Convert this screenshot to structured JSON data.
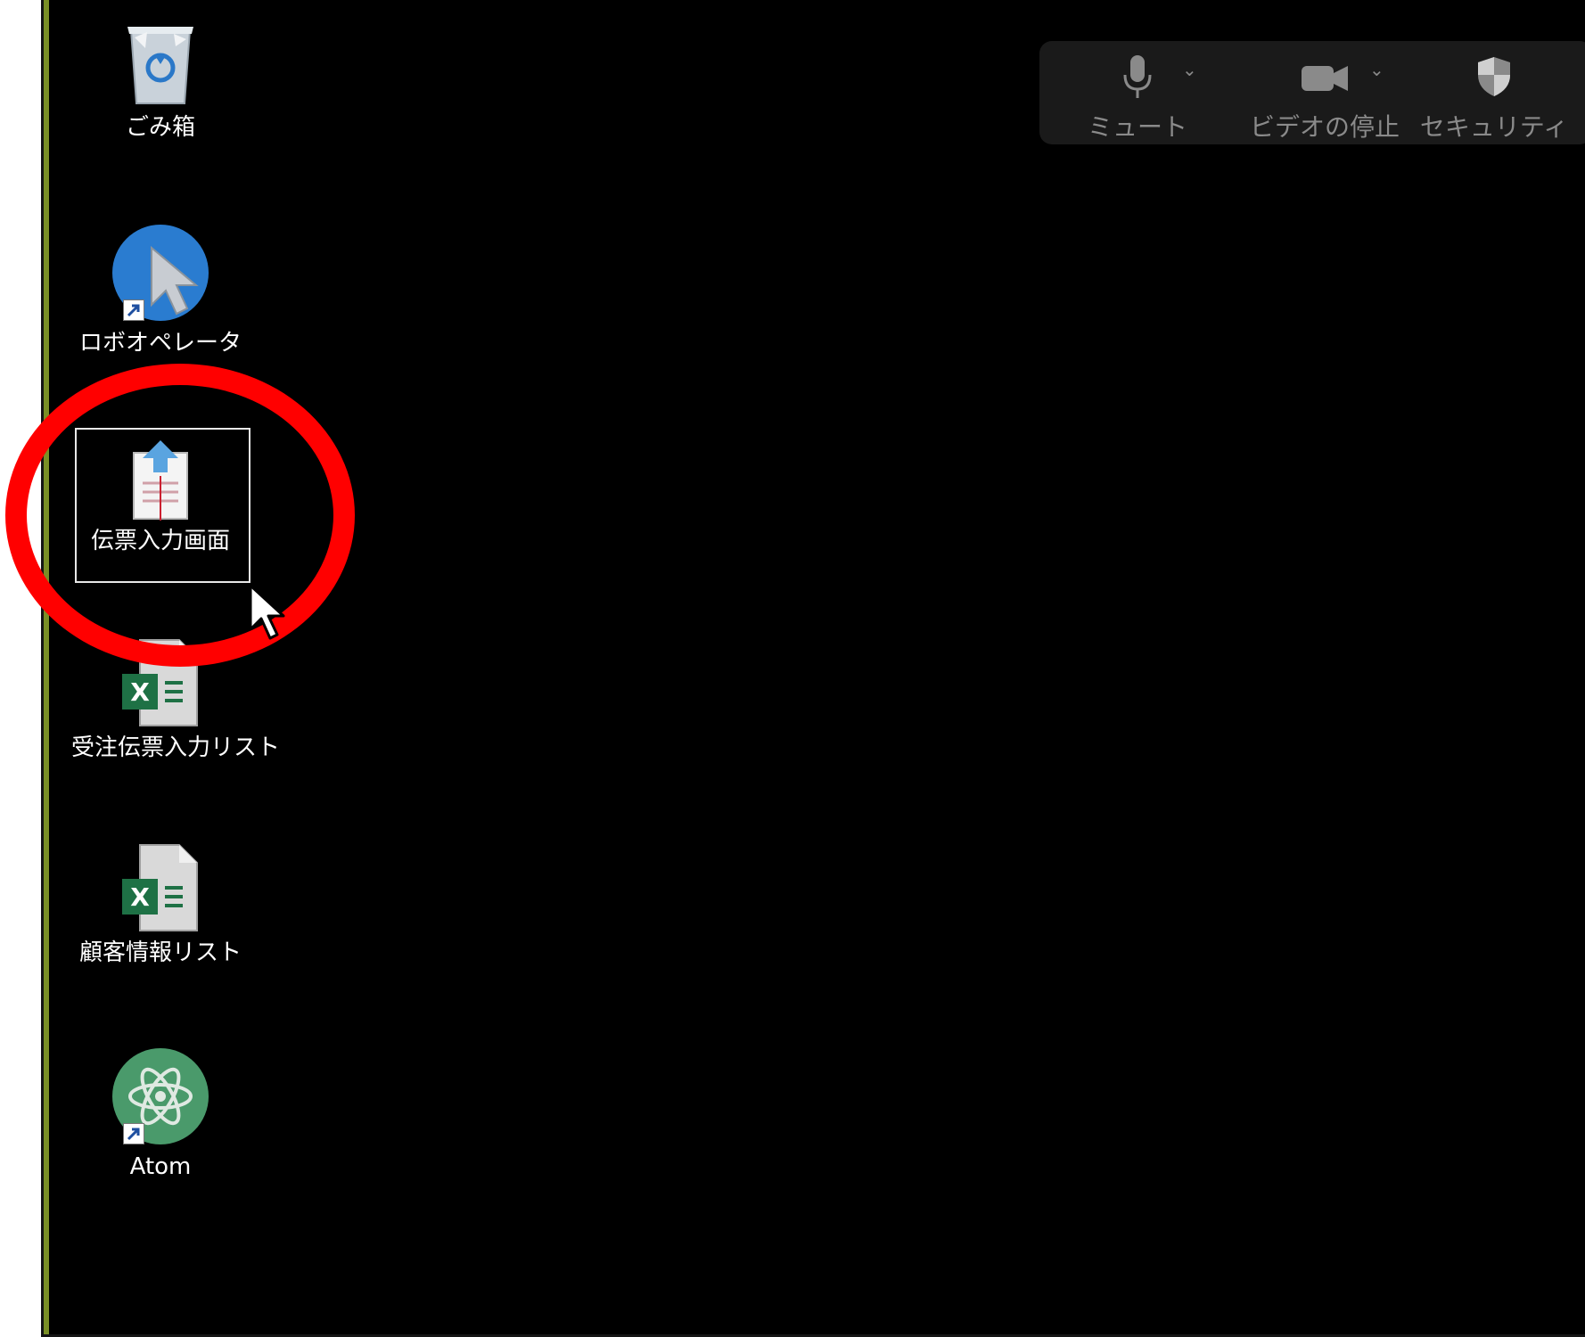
{
  "desktop": {
    "icons": [
      {
        "label": "ごみ箱",
        "icon": "recycle-bin-icon"
      },
      {
        "label": "ロボオペレータ",
        "icon": "robo-operator-icon"
      },
      {
        "label": "伝票入力画面",
        "icon": "document-upload-icon"
      },
      {
        "label": "受注伝票入力リスト",
        "icon": "excel-file-icon"
      },
      {
        "label": "顧客情報リスト",
        "icon": "excel-file-icon"
      },
      {
        "label": "Atom",
        "icon": "atom-icon"
      }
    ]
  },
  "meeting_toolbar": {
    "mute_label": "ミュート",
    "video_label": "ビデオの停止",
    "security_label": "セキュリティ"
  },
  "colors": {
    "frame_border": "#7a8f26",
    "highlight_ring": "#ff0000",
    "excel_green": "#1e7145",
    "atom_green": "#4a9a6b"
  }
}
